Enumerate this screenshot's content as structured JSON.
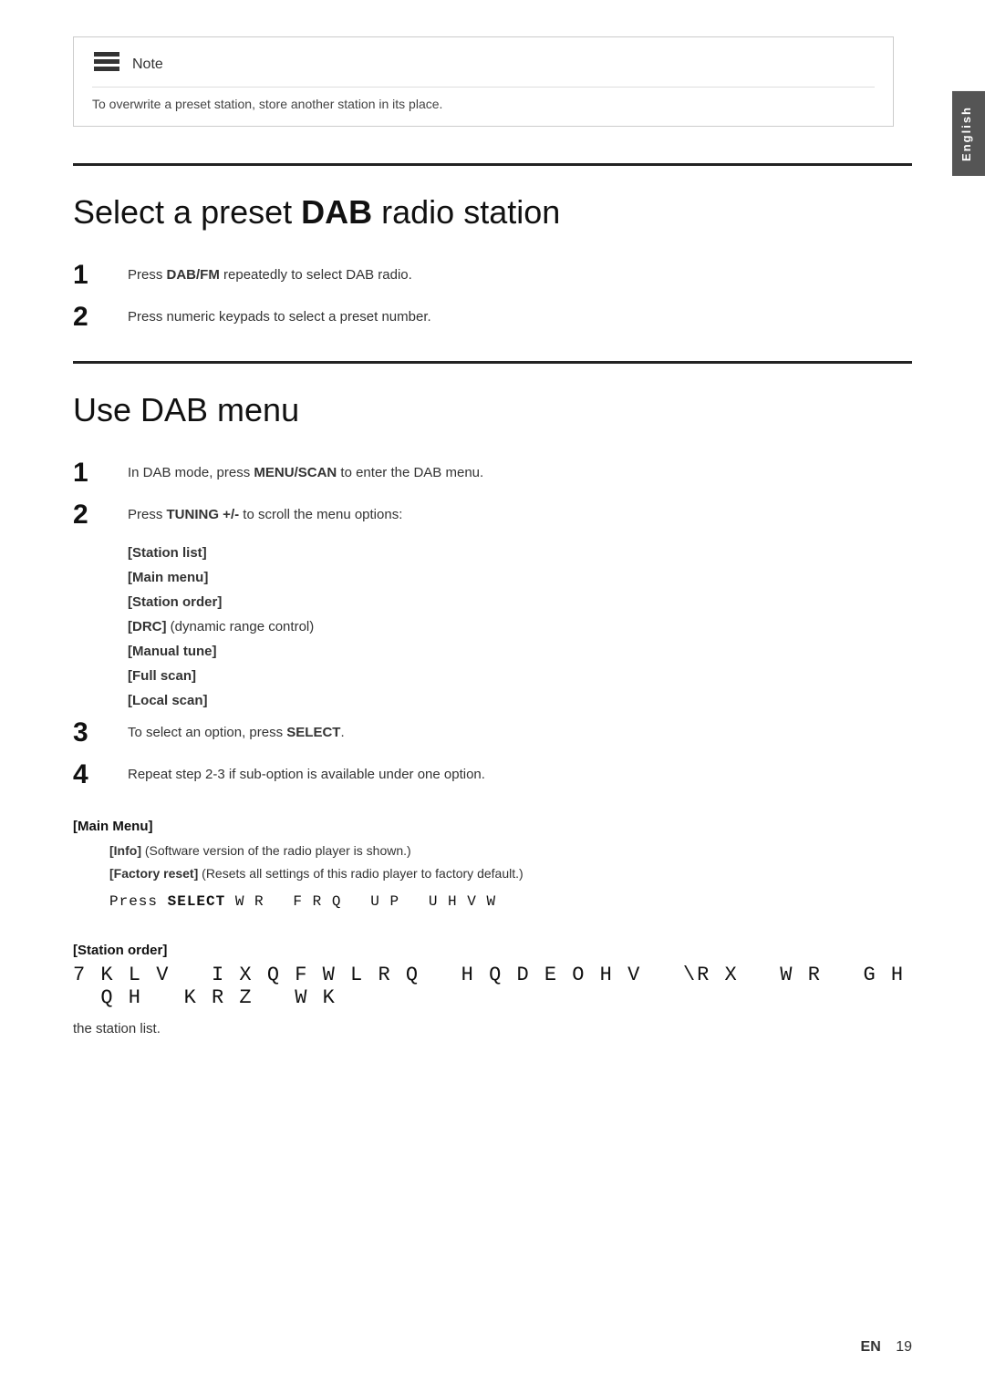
{
  "side_tab": {
    "label": "English"
  },
  "note": {
    "title": "Note",
    "text": "To overwrite a preset station, store another station in its place."
  },
  "section1": {
    "heading_normal": "Select a preset ",
    "heading_bold": "DAB",
    "heading_end": " radio station",
    "steps": [
      {
        "number": "1",
        "text_before": "Press ",
        "bold": "DAB/FM",
        "text_after": " repeatedly to select DAB radio."
      },
      {
        "number": "2",
        "text_before": "Press numeric keypads to select a preset number.",
        "bold": "",
        "text_after": ""
      }
    ]
  },
  "section2": {
    "heading": "Use DAB menu",
    "steps": [
      {
        "number": "1",
        "text_before": "In DAB mode, press ",
        "bold": "MENU/SCAN",
        "text_after": " to enter the DAB menu."
      },
      {
        "number": "2",
        "text_before": "Press ",
        "bold": "TUNING +/-",
        "text_after": " to scroll the menu options:"
      },
      {
        "number": "3",
        "text_before": "To select an option, press ",
        "bold": "SELECT",
        "text_after": "."
      },
      {
        "number": "4",
        "text_before": "Repeat step 2-3 if sub-option is available under one option.",
        "bold": "",
        "text_after": ""
      }
    ],
    "menu_options": [
      {
        "label": "[Station list]",
        "bold": true
      },
      {
        "label": "[Main menu]",
        "bold": true
      },
      {
        "label": "[Station order]",
        "bold": true
      },
      {
        "label": "[DRC]",
        "bold": true,
        "suffix": " (dynamic range control)"
      },
      {
        "label": "[Manual tune]",
        "bold": true
      },
      {
        "label": "[Full scan]",
        "bold": true
      },
      {
        "label": "[Local scan]",
        "bold": true
      }
    ]
  },
  "sub_sections": [
    {
      "title": "[Main Menu]",
      "items": [
        {
          "prefix": "",
          "bold": "[Info]",
          "suffix": " (Software version of the radio player is shown.)"
        },
        {
          "prefix": "",
          "bold": "[Factory reset]",
          "suffix": " (Resets all settings of this radio player to factory default.)"
        }
      ],
      "monospace": {
        "prefix": "Press ",
        "bold": "SELECT",
        "suffix": "   W R   F R Q   U P   U H V W"
      }
    },
    {
      "title": "[Station order]",
      "station_order_line": "7 K L V   I X Q F W L R Q   H Q D E O H V   \\ R X   W R   G H   Q H   K R Z   W K",
      "trailing_text": "the station list."
    }
  ],
  "footer": {
    "en_label": "EN",
    "page_number": "19"
  }
}
